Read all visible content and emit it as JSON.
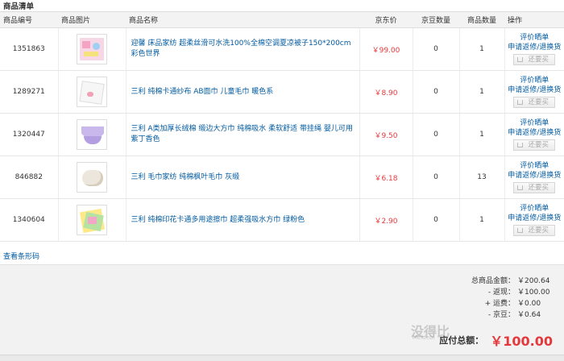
{
  "section_title": "商品清单",
  "columns": {
    "code": "商品编号",
    "picture": "商品图片",
    "name": "商品名称",
    "price": "京东价",
    "beans": "京豆数量",
    "qty": "商品数量",
    "ops": "操作"
  },
  "rows": [
    {
      "code": "1351863",
      "name": "迎馨 床品家纺 超柔丝滑可水洗100%全棉空调夏凉被子150*200cm 彩色世界",
      "price": "￥99.00",
      "beans": "0",
      "qty": "1",
      "thumb": "colorful-quilt"
    },
    {
      "code": "1289271",
      "name": "三利 纯棉卡通纱布 AB面巾 儿童毛巾 暖色系",
      "price": "￥8.90",
      "beans": "0",
      "qty": "1",
      "thumb": "white-gauze-towel"
    },
    {
      "code": "1320447",
      "name": "三利 A类加厚长绒棉 缎边大方巾 纯棉吸水 柔软舒适 带挂绳 婴儿可用 紫丁香色",
      "price": "￥9.50",
      "beans": "0",
      "qty": "1",
      "thumb": "purple-towel"
    },
    {
      "code": "846882",
      "name": "三利 毛巾家纺 纯棉枫叶毛巾 灰缎",
      "price": "￥6.18",
      "beans": "0",
      "qty": "13",
      "thumb": "rolled-towel"
    },
    {
      "code": "1340604",
      "name": "三利 纯棉印花卡通多用途擦巾 超柔强吸水方巾 绿粉色",
      "price": "￥2.90",
      "beans": "0",
      "qty": "1",
      "thumb": "green-pink-cloths"
    }
  ],
  "ops": {
    "review": "评价晒单",
    "return": "申请返修/退换货",
    "buy_again": "还要买"
  },
  "barcode_link": "查看条形码",
  "summary": {
    "goods_total_label": "总商品金额：",
    "goods_total": "￥200.64",
    "cashback_label": "- 返现：",
    "cashback": "￥100.00",
    "shipping_label": "+ 运费：",
    "shipping": "￥0.00",
    "beans_label": "- 京豆：",
    "beans": "￥0.64",
    "payable_label": "应付总额：",
    "payable": "￥100.00"
  },
  "watermark": {
    "text": "没得比",
    "sub": "Meidebi"
  },
  "colors": {
    "link": "#005aa0",
    "price": "#e4393c",
    "header_bg": "#f3f3f3",
    "summary_bg": "#f2f2f2"
  }
}
